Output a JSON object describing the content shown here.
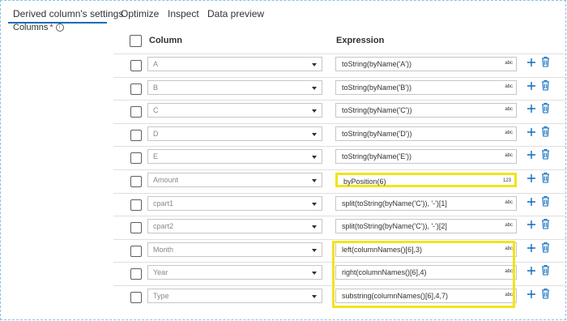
{
  "tabs": [
    {
      "label": "Derived column's settings"
    },
    {
      "label": "Optimize"
    },
    {
      "label": "Inspect"
    },
    {
      "label": "Data preview"
    }
  ],
  "columns_label": "Columns",
  "required_mark": "*",
  "info_icon_glyph": "i",
  "headers": {
    "column": "Column",
    "expression": "Expression"
  },
  "rows": [
    {
      "column": "A",
      "expression": "toString(byName('A'))",
      "type": "abc"
    },
    {
      "column": "B",
      "expression": "toString(byName('B'))",
      "type": "abc"
    },
    {
      "column": "C",
      "expression": "toString(byName('C'))",
      "type": "abc"
    },
    {
      "column": "D",
      "expression": "toString(byName('D'))",
      "type": "abc"
    },
    {
      "column": "E",
      "expression": "toString(byName('E'))",
      "type": "abc"
    },
    {
      "column": "Amount",
      "expression": "byPosition(6)",
      "type": "123"
    },
    {
      "column": "cpart1",
      "expression": "split(toString(byName('C')), '-')[1]",
      "type": "abc"
    },
    {
      "column": "cpart2",
      "expression": "split(toString(byName('C')), '-')[2]",
      "type": "abc"
    },
    {
      "column": "Month",
      "expression": "left(columnNames()[6],3)",
      "type": "abc"
    },
    {
      "column": "Year",
      "expression": "right(columnNames()[6],4)",
      "type": "abc"
    },
    {
      "column": "Type",
      "expression": "substring(columnNames()[6],4,7)",
      "type": "abc"
    }
  ],
  "colors": {
    "accent": "#0f6cbd",
    "highlight": "#f2e31c"
  }
}
